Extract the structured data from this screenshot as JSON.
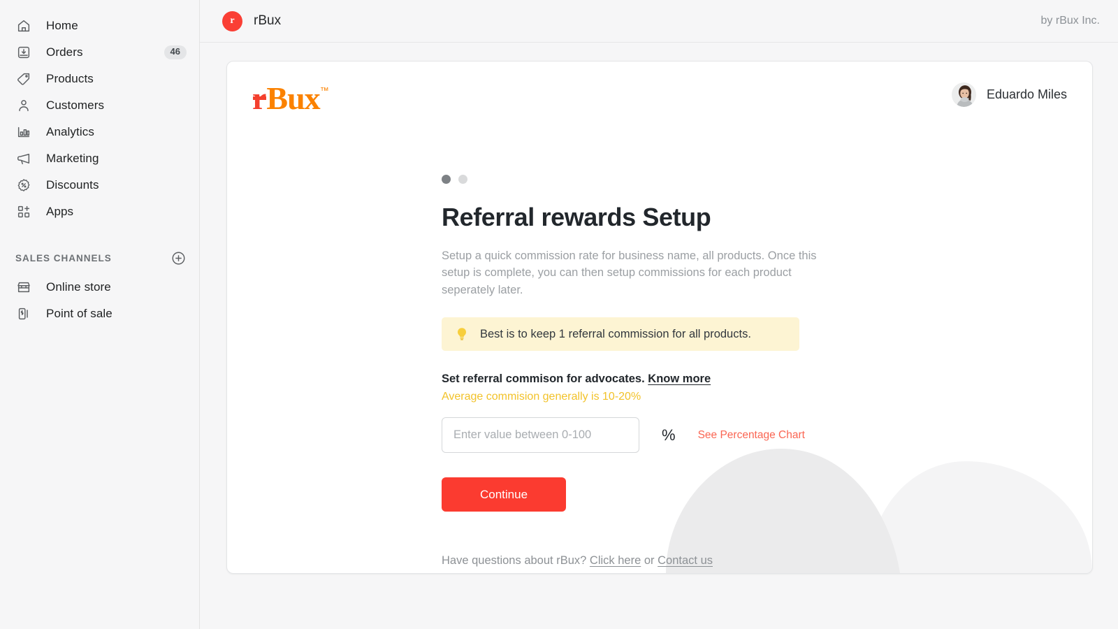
{
  "sidebar": {
    "items": [
      {
        "label": "Home",
        "icon": "home-icon",
        "badge": ""
      },
      {
        "label": "Orders",
        "icon": "orders-icon",
        "badge": "46"
      },
      {
        "label": "Products",
        "icon": "tag-icon",
        "badge": ""
      },
      {
        "label": "Customers",
        "icon": "person-icon",
        "badge": ""
      },
      {
        "label": "Analytics",
        "icon": "bar-chart-icon",
        "badge": ""
      },
      {
        "label": "Marketing",
        "icon": "megaphone-icon",
        "badge": ""
      },
      {
        "label": "Discounts",
        "icon": "discount-badge-icon",
        "badge": ""
      },
      {
        "label": "Apps",
        "icon": "apps-grid-plus-icon",
        "badge": ""
      }
    ],
    "section": {
      "title": "SALES CHANNELS",
      "add_icon": "plus-circle-icon",
      "channels": [
        {
          "label": "Online store",
          "icon": "storefront-icon"
        },
        {
          "label": "Point of sale",
          "icon": "pos-icon"
        }
      ]
    }
  },
  "topbar": {
    "logo_letter": "r",
    "app_name": "rBux",
    "byline": "by rBux Inc."
  },
  "card": {
    "logo": {
      "r": "r",
      "bux": "Bux",
      "tm": "™"
    },
    "user": {
      "name": "Eduardo Miles",
      "avatar": "user-avatar"
    },
    "steps": {
      "total": 2,
      "active_index": 0
    },
    "title": "Referral rewards Setup",
    "description": "Setup a quick commission rate for business name, all products. Once this setup is complete, you can then setup commissions for each product seperately later.",
    "tip": {
      "icon": "lightbulb-icon",
      "text": "Best is to keep 1 referral commission for all products."
    },
    "set_label": "Set referral commison for advocates.",
    "know_more": "Know more",
    "average_note": "Average commision generally is 10-20%",
    "input": {
      "value": "",
      "placeholder": "Enter value between 0-100"
    },
    "percent_sign": "%",
    "percentage_chart_link": "See Percentage Chart",
    "continue_label": "Continue",
    "footer": {
      "question": "Have questions about rBux?",
      "link1": "Click here",
      "joiner": "or",
      "link2": "Contact us"
    }
  },
  "colors": {
    "brand_red": "#fb3b30",
    "logo_orange": "#fb8200",
    "logo_red": "#f4402e",
    "tip_bg": "#fdf4d3",
    "accent_yellow": "#f2c229",
    "link_red": "#fa6552"
  }
}
